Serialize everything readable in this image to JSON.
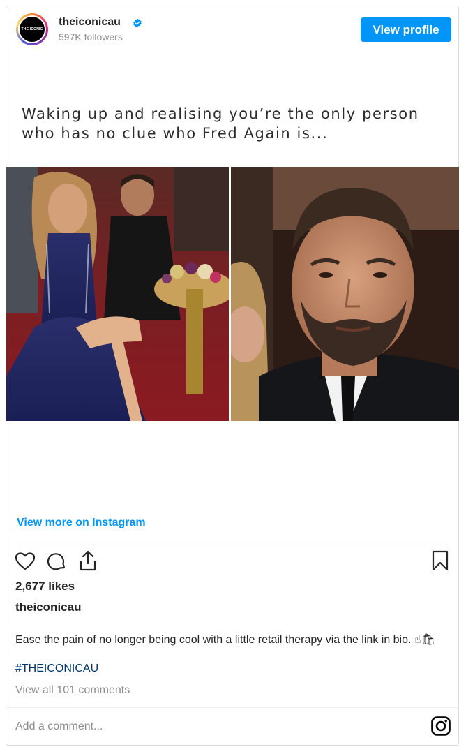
{
  "header": {
    "avatar_text": "THE ICONIC",
    "username": "theiconicau",
    "followers": "597K followers",
    "view_profile_label": "View profile"
  },
  "post": {
    "image_text": "Waking up and realising you’re the only person who has no clue who Fred Again is...",
    "view_more_label": "View more on Instagram",
    "likes": "2,677 likes",
    "caption_user": "theiconicau",
    "caption_text": "Ease the pain of no longer being cool with a little retail therapy via the link in bio.",
    "caption_emoji": "☝🛍",
    "hashtag": "#THEICONICAU",
    "view_comments_label": "View all 101 comments",
    "comment_placeholder": "Add a comment..."
  },
  "icons": {
    "like": "heart-icon",
    "comment": "comment-icon",
    "share": "share-icon",
    "save": "bookmark-icon",
    "instagram": "instagram-icon",
    "verified": "verified-badge-icon"
  },
  "colors": {
    "accent": "#0095f6",
    "hashtag": "#00376b",
    "muted": "#8e8e8e",
    "text": "#262626"
  }
}
